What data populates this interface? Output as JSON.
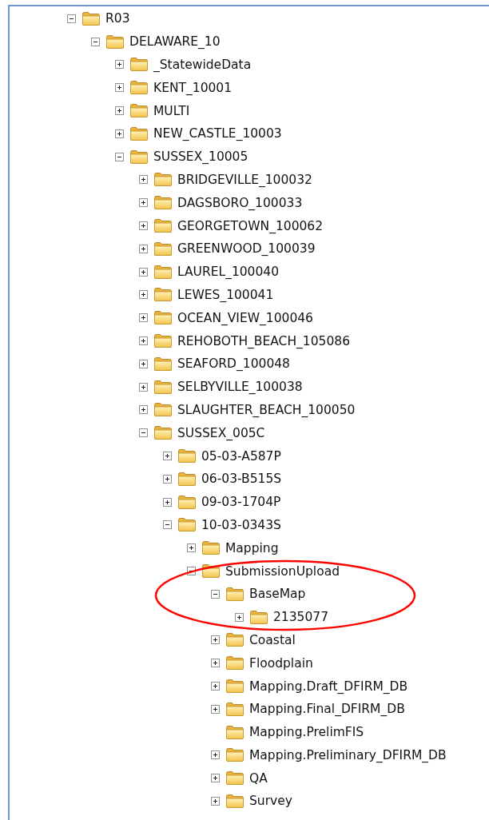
{
  "tree": [
    {
      "label": "R03",
      "kind": "branch",
      "expanded": true,
      "children": [
        {
          "label": "DELAWARE_10",
          "kind": "branch",
          "expanded": true,
          "children": [
            {
              "label": "_StatewideData",
              "kind": "branch",
              "expanded": false
            },
            {
              "label": "KENT_10001",
              "kind": "branch",
              "expanded": false
            },
            {
              "label": "MULTI",
              "kind": "branch",
              "expanded": false
            },
            {
              "label": "NEW_CASTLE_10003",
              "kind": "branch",
              "expanded": false
            },
            {
              "label": "SUSSEX_10005",
              "kind": "branch",
              "expanded": true,
              "children": [
                {
                  "label": "BRIDGEVILLE_100032",
                  "kind": "branch",
                  "expanded": false
                },
                {
                  "label": "DAGSBORO_100033",
                  "kind": "branch",
                  "expanded": false
                },
                {
                  "label": "GEORGETOWN_100062",
                  "kind": "branch",
                  "expanded": false
                },
                {
                  "label": "GREENWOOD_100039",
                  "kind": "branch",
                  "expanded": false
                },
                {
                  "label": "LAUREL_100040",
                  "kind": "branch",
                  "expanded": false
                },
                {
                  "label": "LEWES_100041",
                  "kind": "branch",
                  "expanded": false
                },
                {
                  "label": "OCEAN_VIEW_100046",
                  "kind": "branch",
                  "expanded": false
                },
                {
                  "label": "REHOBOTH_BEACH_105086",
                  "kind": "branch",
                  "expanded": false
                },
                {
                  "label": "SEAFORD_100048",
                  "kind": "branch",
                  "expanded": false
                },
                {
                  "label": "SELBYVILLE_100038",
                  "kind": "branch",
                  "expanded": false
                },
                {
                  "label": "SLAUGHTER_BEACH_100050",
                  "kind": "branch",
                  "expanded": false
                },
                {
                  "label": "SUSSEX_005C",
                  "kind": "branch",
                  "expanded": true,
                  "children": [
                    {
                      "label": "05-03-A587P",
                      "kind": "branch",
                      "expanded": false
                    },
                    {
                      "label": "06-03-B515S",
                      "kind": "branch",
                      "expanded": false
                    },
                    {
                      "label": "09-03-1704P",
                      "kind": "branch",
                      "expanded": false
                    },
                    {
                      "label": "10-03-0343S",
                      "kind": "branch",
                      "expanded": true,
                      "children": [
                        {
                          "label": "Mapping",
                          "kind": "branch",
                          "expanded": false
                        },
                        {
                          "label": "SubmissionUpload",
                          "kind": "branch",
                          "expanded": true,
                          "children": [
                            {
                              "label": "BaseMap",
                              "kind": "branch",
                              "expanded": true,
                              "children": [
                                {
                                  "label": "2135077",
                                  "kind": "branch",
                                  "expanded": false
                                }
                              ]
                            },
                            {
                              "label": "Coastal",
                              "kind": "branch",
                              "expanded": false
                            },
                            {
                              "label": "Floodplain",
                              "kind": "branch",
                              "expanded": false
                            },
                            {
                              "label": "Mapping.Draft_DFIRM_DB",
                              "kind": "branch",
                              "expanded": false
                            },
                            {
                              "label": "Mapping.Final_DFIRM_DB",
                              "kind": "branch",
                              "expanded": false
                            },
                            {
                              "label": "Mapping.PrelimFIS",
                              "kind": "leaf"
                            },
                            {
                              "label": "Mapping.Preliminary_DFIRM_DB",
                              "kind": "branch",
                              "expanded": false
                            },
                            {
                              "label": "QA",
                              "kind": "branch",
                              "expanded": false
                            },
                            {
                              "label": "Survey",
                              "kind": "branch",
                              "expanded": false
                            }
                          ]
                        }
                      ]
                    }
                  ]
                }
              ]
            }
          ]
        }
      ]
    }
  ]
}
